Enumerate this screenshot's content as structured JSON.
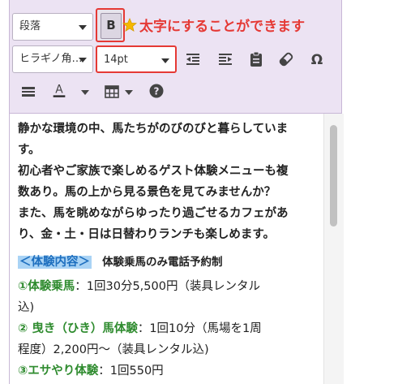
{
  "toolbar": {
    "paragraph_select": "段落",
    "bold_label": "B",
    "font_select": "ヒラギノ角…",
    "size_select": "14pt",
    "annotation": "太字にすることができます"
  },
  "content": {
    "intro_lines": [
      "静かな環境の中、馬たちがのびのびと暮らしていま",
      "す。",
      "初心者やご家族で楽しめるゲスト体験メニューも複",
      "数あり。馬の上から見る景色を見てみませんか？",
      "また、馬を眺めながらゆったり過ごせるカフェがあ",
      "り、金・土・日は日替わりランチも楽しめます。"
    ],
    "section_heading": "＜体験内容＞",
    "section_note": "体験乗馬のみ電話予約制",
    "items": [
      {
        "name": "①体験乗馬",
        "detail_1": "：1回30分5,500円（装具レンタル",
        "detail_2": "込)"
      },
      {
        "name": "② 曳き（ひき）馬体験",
        "detail_1": "：1回10分（馬場を1周",
        "detail_2": "程度）2,200円～（装具レンタル込)"
      },
      {
        "name": "③エサやり体験",
        "detail_1": "：1回550円"
      }
    ]
  },
  "colors": {
    "toolbar_bg": "#ece3f3",
    "highlight_border": "#e53935",
    "heading_highlight": "#a9d3f5",
    "green_text": "#2e8b2e"
  },
  "icons": [
    "indent-decrease-icon",
    "indent-increase-icon",
    "paste-icon",
    "eraser-icon",
    "omega-icon",
    "horizontal-rule-icon",
    "text-color-icon",
    "table-icon",
    "help-icon",
    "star-icon"
  ]
}
